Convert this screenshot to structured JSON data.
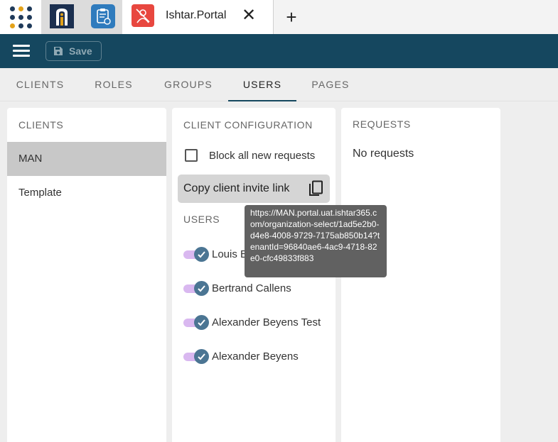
{
  "browser": {
    "active_tab_title": "Ishtar.Portal",
    "close_glyph": "✕",
    "new_tab_glyph": "+",
    "launcher_dot_colors": [
      "#1f3a5a",
      "#e3a21a",
      "#1f3a5a",
      "#1f3a5a",
      "#1f3a5a",
      "#1f3a5a",
      "#e3a21a",
      "#1f3a5a",
      "#1f3a5a"
    ]
  },
  "appbar": {
    "save_label": "Save",
    "background": "#15475f"
  },
  "tabs": [
    {
      "label": "CLIENTS"
    },
    {
      "label": "ROLES"
    },
    {
      "label": "GROUPS"
    },
    {
      "label": "USERS",
      "active": true
    },
    {
      "label": "PAGES"
    }
  ],
  "clients_panel": {
    "heading": "CLIENTS",
    "items": [
      {
        "label": "MAN",
        "selected": true
      },
      {
        "label": "Template"
      }
    ]
  },
  "config_panel": {
    "heading": "CLIENT CONFIGURATION",
    "block_label": "Block all new requests",
    "block_checked": false,
    "copy_label": "Copy client invite link",
    "users_heading": "USERS",
    "users": [
      {
        "name": "Louis B",
        "enabled": true
      },
      {
        "name": "Bertrand Callens",
        "enabled": true
      },
      {
        "name": "Alexander Beyens Test",
        "enabled": true
      },
      {
        "name": "Alexander Beyens",
        "enabled": true
      }
    ]
  },
  "requests_panel": {
    "heading": "REQUESTS",
    "empty_text": "No requests"
  },
  "tooltip": {
    "text": "https://MAN.portal.uat.ishtar365.com/organization-select/1ad5e2b0-d4e8-4008-9729-7175ab850b14?tenantId=96840ae6-4ac9-4718-82e0-cfc49833f883"
  },
  "icons": {
    "launcher": "app-grid-icon",
    "menu": "hamburger-menu-icon",
    "save": "floppy-disk-icon",
    "copy": "copy-icon",
    "toggle_check": "check-icon"
  }
}
